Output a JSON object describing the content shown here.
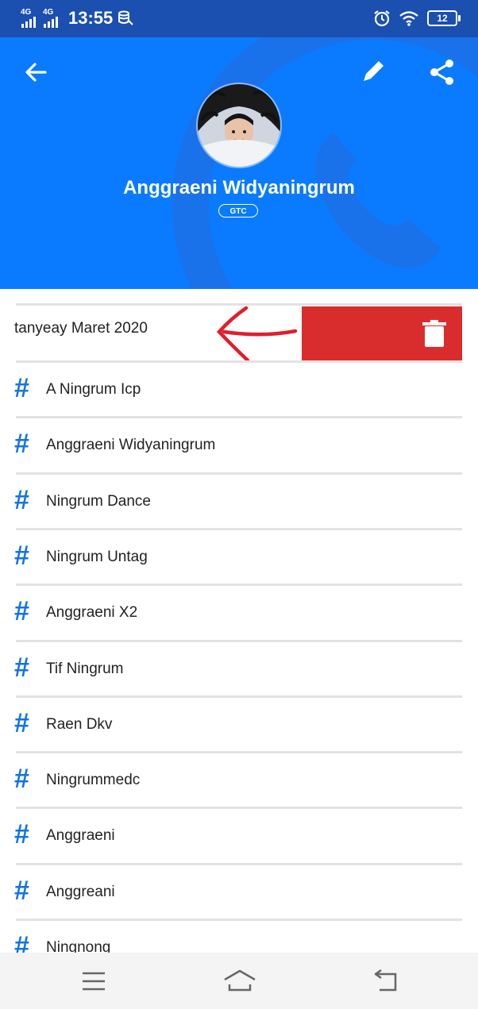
{
  "status_bar": {
    "network1": "4G",
    "network2": "4G",
    "time": "13:55",
    "battery": "12"
  },
  "header": {
    "name": "Anggraeni Widyaningrum",
    "badge": "GTC",
    "icons": [
      "back-arrow-icon",
      "edit-pencil-icon",
      "share-icon"
    ],
    "bg_color": "#0a7bff"
  },
  "list": {
    "swiped_item": "tanyeay Maret 2020",
    "items": [
      "A Ningrum Icp",
      "Anggraeni Widyaningrum",
      "Ningrum Dance",
      "Ningrum Untag",
      "Anggraeni X2",
      "Tif Ningrum",
      "Raen Dkv",
      "Ningrummedc",
      "Anggraeni",
      "Anggreani",
      "Ningnong"
    ],
    "hash_symbol": "#",
    "accent_color": "#1473e6",
    "delete_color": "#d92d2d"
  },
  "nav_bar": {
    "icons": [
      "menu-icon",
      "home-icon",
      "back-icon"
    ]
  }
}
